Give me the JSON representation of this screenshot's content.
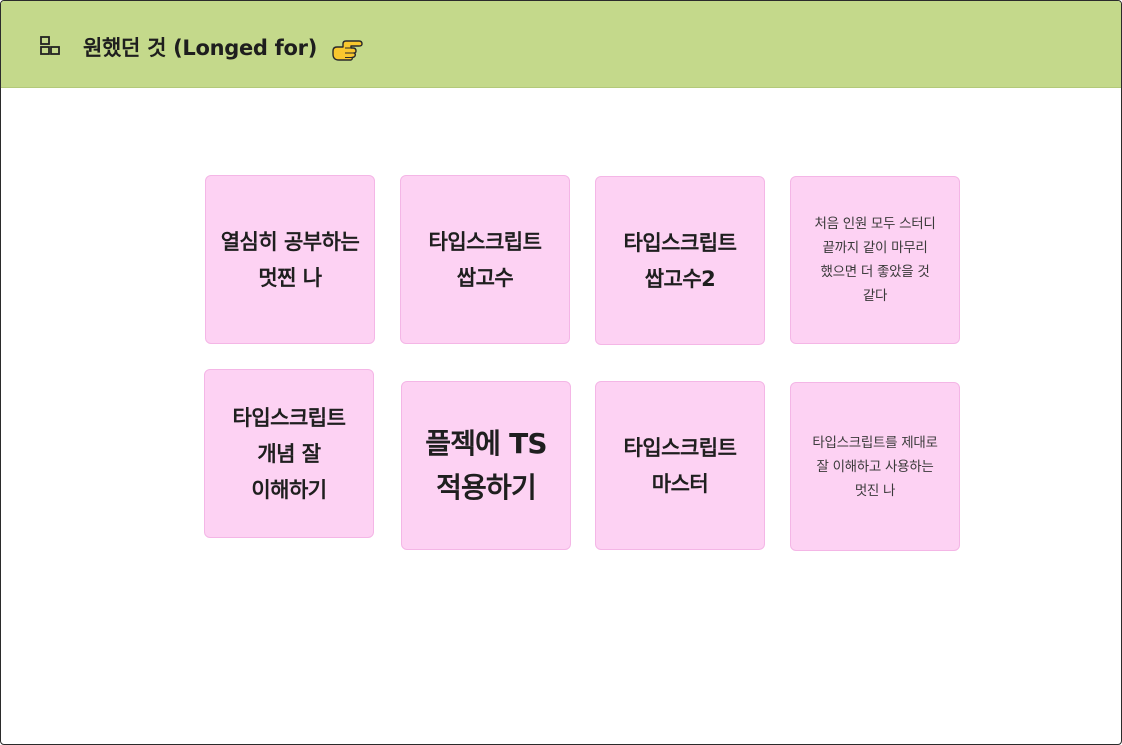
{
  "header": {
    "title": "원했던 것 (Longed for)",
    "background_color": "#c4d98b",
    "icon": "frame-icon",
    "trailing_icon": "pointing-hand-icon"
  },
  "notes": [
    {
      "text": "열심히 공부하는\n멋찐 나"
    },
    {
      "text": "타입스크립트\n쌉고수"
    },
    {
      "text": "타입스크립트\n쌉고수2"
    },
    {
      "text": "처음 인원 모두 스터디\n끝까지 같이 마무리\n했으면 더 좋았을 것\n같다"
    },
    {
      "text": "타입스크립트\n개념 잘\n이해하기"
    },
    {
      "text": "플젝에 TS\n적용하기"
    },
    {
      "text": "타입스크립트\n마스터"
    },
    {
      "text": "타입스크립트를 제대로\n잘 이해하고 사용하는\n멋진 나"
    }
  ],
  "note_color": "#fdd2f3"
}
